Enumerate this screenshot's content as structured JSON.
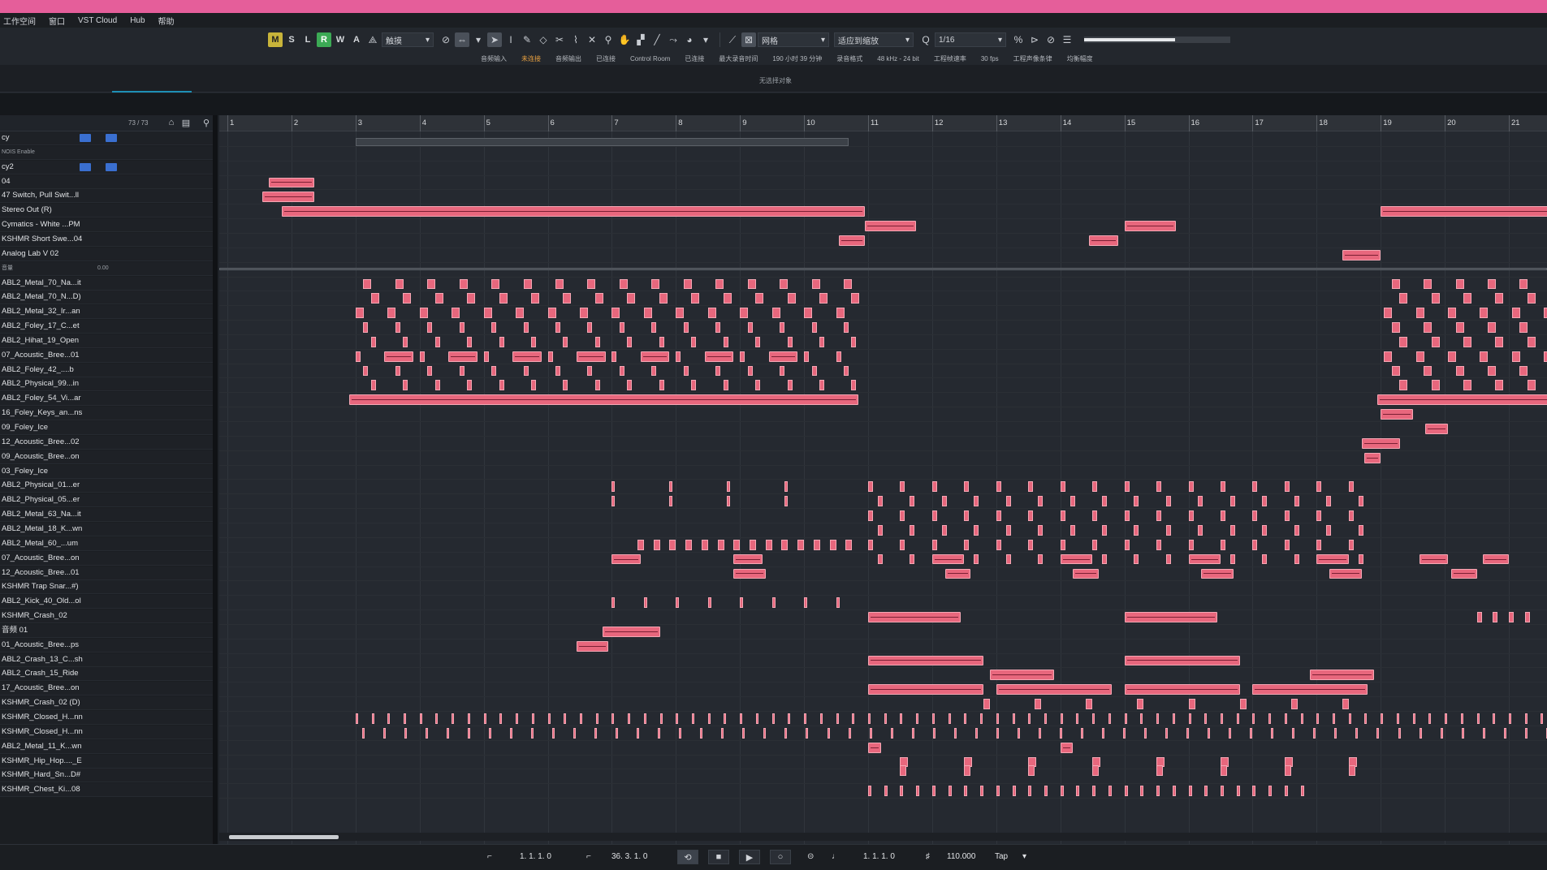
{
  "menu": [
    "工作空间",
    "窗口",
    "VST Cloud",
    "Hub",
    "帮助"
  ],
  "toolbar": {
    "msl": [
      "M",
      "S",
      "L",
      "R",
      "W",
      "A"
    ],
    "mode_label": "触摸",
    "grid_label": "网格",
    "quantize_label": "适应到缩放",
    "quant_value": "1/16",
    "zoom_level": 0.62
  },
  "status": [
    "音频输入",
    "未连接",
    "音频输出",
    "已连接",
    "Control Room",
    "已连接",
    "最大录音时间",
    "190 小时 39 分钟",
    "录音格式",
    "48 kHz - 24 bit",
    "工程帧速率",
    "30 fps",
    "工程声像条律",
    "均衡幅度"
  ],
  "info": {
    "no_selection": "无选择对象"
  },
  "tracks_count": "73 / 73",
  "tracks": [
    {
      "name": "cy",
      "kind": "folder"
    },
    {
      "name": "NOIS Enable",
      "kind": "small"
    },
    {
      "name": "cy2",
      "kind": "folder"
    },
    {
      "name": "04"
    },
    {
      "name": "47 Switch, Pull Swit...ll"
    },
    {
      "name": "Stereo Out (R)"
    },
    {
      "name": "Cymatics - White ...PM"
    },
    {
      "name": "KSHMR Short Swe...04"
    },
    {
      "name": "Analog Lab V 02"
    },
    {
      "name": "音量",
      "kind": "small",
      "value": "0.00"
    },
    {
      "name": "ABL2_Metal_70_Na...it"
    },
    {
      "name": "ABL2_Metal_70_N...D)"
    },
    {
      "name": "ABL2_Metal_32_Ir...an"
    },
    {
      "name": "ABL2_Foley_17_C...et"
    },
    {
      "name": "ABL2_Hihat_19_Open"
    },
    {
      "name": "07_Acoustic_Bree...01"
    },
    {
      "name": "ABL2_Foley_42_....b"
    },
    {
      "name": "ABL2_Physical_99...in"
    },
    {
      "name": "ABL2_Foley_54_Vi...ar"
    },
    {
      "name": "16_Foley_Keys_an...ns"
    },
    {
      "name": "09_Foley_Ice"
    },
    {
      "name": "12_Acoustic_Bree...02"
    },
    {
      "name": "09_Acoustic_Bree...on"
    },
    {
      "name": "03_Foley_Ice"
    },
    {
      "name": "ABL2_Physical_01...er"
    },
    {
      "name": "ABL2_Physical_05...er"
    },
    {
      "name": "ABL2_Metal_63_Na...it"
    },
    {
      "name": "ABL2_Metal_18_K...wn"
    },
    {
      "name": "ABL2_Metal_60_...um"
    },
    {
      "name": "07_Acoustic_Bree...on"
    },
    {
      "name": "12_Acoustic_Bree...01"
    },
    {
      "name": "KSHMR Trap Snar...#)"
    },
    {
      "name": "ABL2_Kick_40_Old...ol"
    },
    {
      "name": "KSHMR_Crash_02"
    },
    {
      "name": "音频 01"
    },
    {
      "name": "01_Acoustic_Bree...ps"
    },
    {
      "name": "ABL2_Crash_13_C...sh"
    },
    {
      "name": "ABL2_Crash_15_Ride"
    },
    {
      "name": "17_Acoustic_Bree...on"
    },
    {
      "name": "KSHMR_Crash_02 (D)"
    },
    {
      "name": "KSHMR_Closed_H...nn"
    },
    {
      "name": "KSHMR_Closed_H...nn"
    },
    {
      "name": "ABL2_Metal_11_K...wn"
    },
    {
      "name": "KSHMR_Hip_Hop...._E"
    },
    {
      "name": "KSHMR_Hard_Sn...D#"
    },
    {
      "name": "KSHMR_Chest_Ki...08"
    }
  ],
  "bars": [
    "1",
    "2",
    "3",
    "4",
    "5",
    "6",
    "7",
    "8",
    "9",
    "10",
    "11",
    "12",
    "13",
    "14",
    "15",
    "16",
    "17",
    "18",
    "19",
    "20",
    "21"
  ],
  "transport": {
    "left_locator": "1. 1. 1.  0",
    "right_locator": "36. 3. 1.  0",
    "position": "1. 1. 1.  0",
    "tempo": "110.000",
    "tap": "Tap"
  }
}
